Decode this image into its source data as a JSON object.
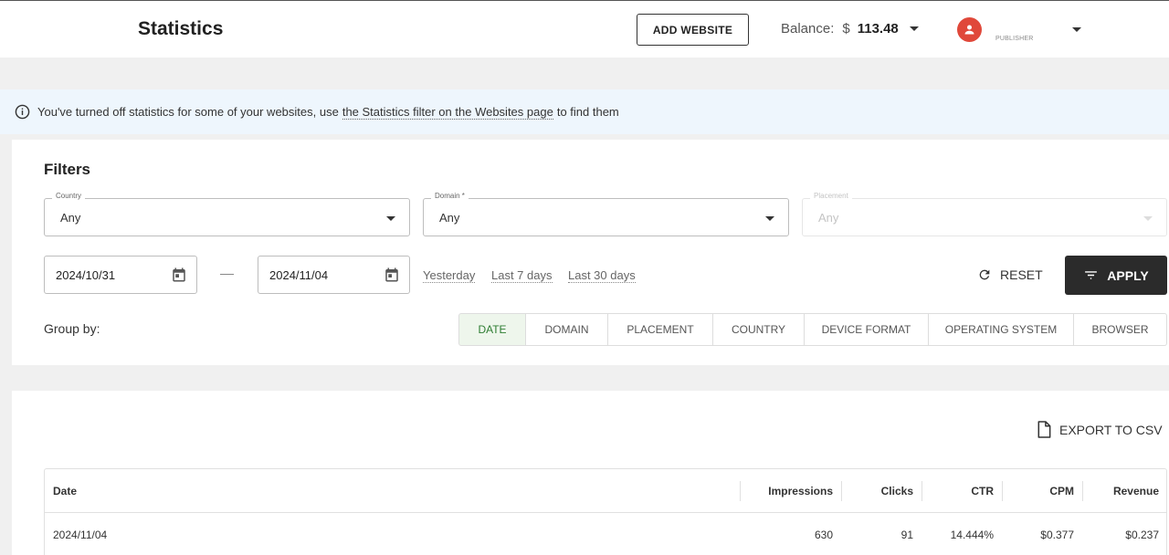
{
  "header": {
    "title": "Statistics",
    "add_website_label": "ADD WEBSITE",
    "balance_label": "Balance:",
    "balance_currency": "$",
    "balance_amount": "113.48",
    "user_role": "PUBLISHER"
  },
  "banner": {
    "text_before": "You've turned off statistics for some of your websites, use",
    "link_text": "the Statistics filter on the Websites page",
    "text_after": "to find them"
  },
  "filters": {
    "title": "Filters",
    "country": {
      "label": "Country",
      "value": "Any"
    },
    "domain": {
      "label": "Domain *",
      "value": "Any"
    },
    "placement": {
      "label": "Placement",
      "value": "Any",
      "disabled": true
    },
    "date_from": "2024/10/31",
    "date_to": "2024/11/04",
    "quick_ranges": [
      "Yesterday",
      "Last 7 days",
      "Last 30 days"
    ],
    "reset_label": "RESET",
    "apply_label": "APPLY",
    "group_by_label": "Group by:",
    "group_by_options": [
      "DATE",
      "DOMAIN",
      "PLACEMENT",
      "COUNTRY",
      "DEVICE FORMAT",
      "OPERATING SYSTEM",
      "BROWSER"
    ],
    "group_by_selected": "DATE"
  },
  "table": {
    "export_label": "EXPORT TO CSV",
    "columns": [
      "Date",
      "Impressions",
      "Clicks",
      "CTR",
      "CPM",
      "Revenue"
    ],
    "rows": [
      {
        "date": "2024/11/04",
        "impressions": "630",
        "clicks": "91",
        "ctr": "14.444%",
        "cpm": "$0.377",
        "revenue": "$0.237"
      }
    ]
  },
  "colors": {
    "avatar": "#e0483a",
    "banner_bg": "#eef6fd",
    "active_tab_bg": "#eef6ec",
    "active_tab_text": "#2e7d32",
    "apply_bg": "#2b2b2b"
  }
}
